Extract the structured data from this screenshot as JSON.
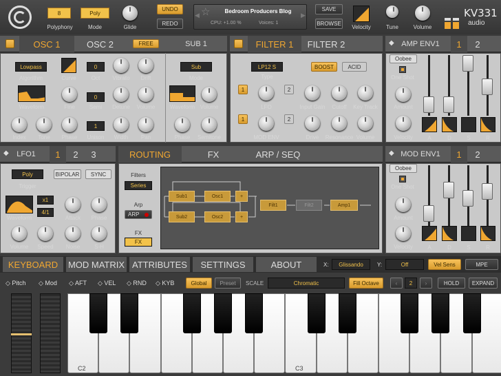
{
  "top": {
    "polyphony_value": "8",
    "polyphony_label": "Polyphony",
    "mode_value": "Poly",
    "mode_label": "Mode",
    "glide_label": "Glide",
    "undo": "UNDO",
    "redo": "REDO",
    "preset_name": "Bedroom Producers Blog",
    "cpu": "CPU: +1.00 %",
    "voices": "Voices: 1",
    "save": "SAVE",
    "browse": "BROWSE",
    "velocity": "Velocity",
    "tune": "Tune",
    "volume": "Volume",
    "brand_big": "KV331",
    "brand_small": "audio"
  },
  "osc": {
    "tab1": "OSC 1",
    "tab2": "OSC 2",
    "free": "FREE",
    "sub_title": "SUB 1",
    "algorithm_value": "Lowpass",
    "algorithm": "Algorithm",
    "curve": "Curve",
    "oct_value": "0",
    "oct": "Oct",
    "vibrato": "Vibrato",
    "drift": "Drift",
    "waveform": "Waveform",
    "fine": "Fine",
    "semi_value": "0",
    "semi": "Semi",
    "detune": "Detune",
    "volume": "Volume",
    "index": "Index",
    "tone": "Tone",
    "phase": "Phase",
    "unison_value": "1",
    "unison": "Unison",
    "width": "Width",
    "pan": "Pan",
    "sub_mode_value": "Sub",
    "sub_mode": "Mode",
    "sub_waveform": "Waveform",
    "sub_volume": "Volume",
    "sub_phase": "Phase",
    "sub_semitone": "Semitone"
  },
  "filter": {
    "tab1": "FILTER 1",
    "tab2": "FILTER 2",
    "type_value": "LP12 S",
    "type": "Type",
    "boost": "BOOST",
    "acid": "ACID",
    "lfo": "LFO",
    "input_gain": "Input Gain",
    "cutoff": "Cutoff",
    "key_track": "Key Track",
    "mod_env": "MOD ENV",
    "drive": "Drive",
    "resonance": "Resonance",
    "volume": "Volume",
    "n1": "1",
    "n2": "2",
    "n3": "1",
    "n4": "2"
  },
  "amp": {
    "title": "AMP ENV1",
    "t1": "1",
    "t2": "2",
    "oobee": "Oobee",
    "one_shot": "One Shot",
    "amount": "Amount",
    "velocity": "Velocity",
    "a": "A",
    "d": "D",
    "s": "S",
    "r": "R"
  },
  "lfo": {
    "title": "LFO1",
    "t1": "1",
    "t2": "2",
    "t3": "3",
    "poly": "Poly",
    "bipolar": "BIPOLAR",
    "sync": "SYNC",
    "trigger": "Trigger",
    "x1": "x1",
    "ratio": "4/1",
    "waveform": "Waveform",
    "attack": "Attack",
    "phase": "Phase",
    "volume": "Volume",
    "speed": "Speed",
    "noise": "Noise",
    "sh": "S-H"
  },
  "routing": {
    "tab1": "ROUTING",
    "tab2": "FX",
    "tab3": "ARP / SEQ",
    "filters": "Filters",
    "series": "Series",
    "arp": "Arp",
    "arp_btn": "ARP",
    "fx": "FX",
    "fx_btn": "FX",
    "sub1": "Sub1",
    "osc1": "Osc1",
    "sub2": "Sub2",
    "osc2": "Osc2",
    "plus1": "+",
    "plus2": "+",
    "filt1": "Filt1",
    "filt2": "Filt2",
    "amp1": "Amp1"
  },
  "mod": {
    "title": "MOD ENV1",
    "t1": "1",
    "t2": "2",
    "oobee": "Oobee",
    "one_shot": "One Shot",
    "amount": "Amount",
    "velocity": "Velocity",
    "a": "A",
    "d": "D",
    "s": "S",
    "r": "R"
  },
  "bottom_tabs": {
    "keyboard": "KEYBOARD",
    "mod_matrix": "MOD MATRIX",
    "attributes": "ATTRIBUTES",
    "settings": "SETTINGS",
    "about": "ABOUT",
    "x_label": "X:",
    "x_value": "Glissando",
    "y_label": "Y:",
    "y_value": "Off",
    "vel_sens": "Vel Sens",
    "mpe": "MPE"
  },
  "kbd_bar": {
    "pitch": "Pitch",
    "mod": "Mod",
    "aft": "AFT",
    "vel": "VEL",
    "rnd": "RND",
    "kyb": "KYB",
    "global": "Global",
    "preset": "Preset",
    "scale": "SCALE",
    "scale_value": "Chromatic",
    "fill_octave": "Fill Octave",
    "octave": "2",
    "hold": "HOLD",
    "expand": "EXPAND"
  },
  "keys": {
    "c2": "C2",
    "c3": "C3"
  },
  "colors": {
    "accent": "#f0a731",
    "panel": "#c9c9c9",
    "dark": "#3b3b3b"
  }
}
